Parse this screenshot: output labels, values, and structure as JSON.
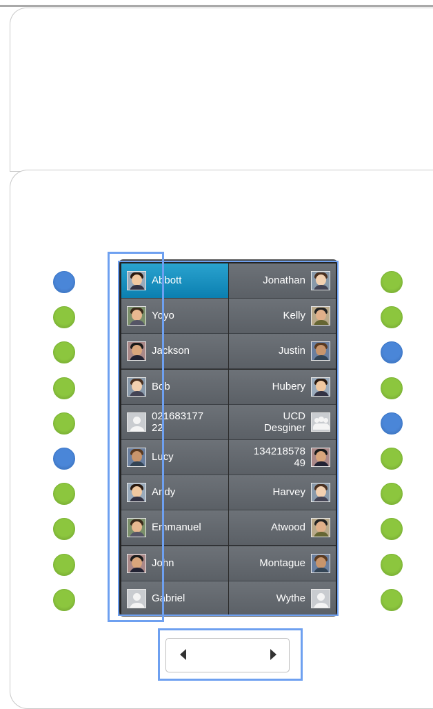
{
  "contacts_left": [
    {
      "name": "Abbott",
      "status": "online",
      "avatar": "photo",
      "selected": true
    },
    {
      "name": "Yoyo",
      "status": "available",
      "avatar": "photo"
    },
    {
      "name": "Jackson",
      "status": "available",
      "avatar": "photo"
    },
    {
      "name": "Bob",
      "status": "available",
      "avatar": "photo"
    },
    {
      "name": "02168317722",
      "line1": "021683177",
      "line2": "22",
      "status": "available",
      "avatar": "placeholder"
    },
    {
      "name": "Lucy",
      "status": "online",
      "avatar": "photo"
    },
    {
      "name": "Andy",
      "status": "available",
      "avatar": "photo"
    },
    {
      "name": "Emmanuel",
      "status": "available",
      "avatar": "photo"
    },
    {
      "name": "John",
      "status": "available",
      "avatar": "photo"
    },
    {
      "name": "Gabriel",
      "status": "available",
      "avatar": "placeholder"
    }
  ],
  "contacts_right": [
    {
      "name": "Jonathan",
      "status": "available",
      "avatar": "photo"
    },
    {
      "name": "Kelly",
      "status": "available",
      "avatar": "photo"
    },
    {
      "name": "Justin",
      "status": "online",
      "avatar": "photo"
    },
    {
      "name": "Hubery",
      "status": "available",
      "avatar": "photo"
    },
    {
      "name": "UCD Desginer",
      "line1": "UCD",
      "line2": "Desginer",
      "status": "online",
      "avatar": "group"
    },
    {
      "name": "13421857849",
      "line1": "134218578",
      "line2": "49",
      "status": "available",
      "avatar": "photo"
    },
    {
      "name": "Harvey",
      "status": "available",
      "avatar": "photo"
    },
    {
      "name": "Atwood",
      "status": "available",
      "avatar": "photo"
    },
    {
      "name": "Montague",
      "status": "available",
      "avatar": "photo"
    },
    {
      "name": "Wythe",
      "status": "available",
      "avatar": "placeholder"
    }
  ],
  "pager": {
    "prev_icon": "triangle-left-icon",
    "next_icon": "triangle-right-icon"
  },
  "colors": {
    "status_available": "#8cc63e",
    "status_online": "#4a86d8",
    "selected_row": "#1a90c0",
    "highlight": "#6ea0f0"
  }
}
